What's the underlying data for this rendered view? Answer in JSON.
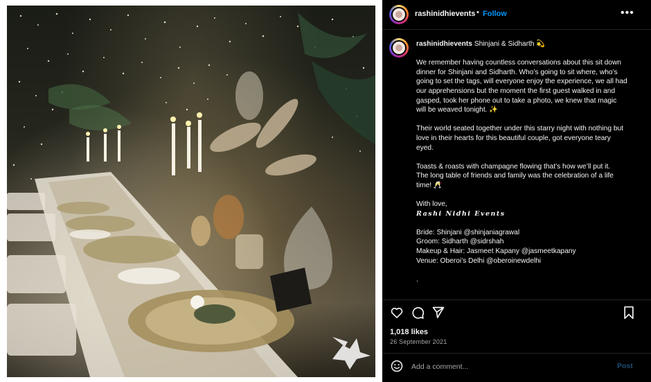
{
  "post": {
    "image_alt": "Candlelit sit-down dinner table under a starry canopy",
    "watermark_icon": "pegasus-icon"
  },
  "header": {
    "username": "rashinidhievents",
    "separator": "•",
    "follow_label": "Follow",
    "more_icon": "more-options-icon",
    "more_label": "•••"
  },
  "caption": {
    "username": "rashinidhievents",
    "title": "Shinjani & Sidharth 💫",
    "paragraph1": "We remember having countless conversations about this sit down dinner for Shinjani and Sidharth. Who’s going to sit where, who’s going to set the tags, will everyone enjoy the experience, we all had our apprehensions but the moment the first guest walked in and gasped, took her phone out to take a photo, we knew that magic will be weaved tonight. ✨",
    "paragraph2": "Their world seated together under this starry night with nothing but love in their hearts for this beautiful couple, got everyone teary eyed.",
    "paragraph3_line1": "Toasts & roasts with champagne flowing that’s how we’ll put it.",
    "paragraph3_line2": "The long table of friends and family was the celebration of a life time! 🥂",
    "signoff": "With love,",
    "signature": "Rashi Nidhi Events",
    "credit_bride": "Bride: Shinjani @shinjaniagrawal",
    "credit_groom": "Groom: Sidharth @sidrshah",
    "credit_makeup": "Makeup & Hair: Jasmeet Kapany @jasmeetkapany",
    "credit_venue": "Venue: Oberoi’s Delhi @oberoinewdelhi",
    "trailing_dot": "."
  },
  "actions": {
    "like_icon": "heart-icon",
    "comment_icon": "comment-bubble-icon",
    "share_icon": "paper-plane-icon",
    "save_icon": "bookmark-icon"
  },
  "stats": {
    "likes": "1,018 likes",
    "date": "26 September 2021"
  },
  "comment": {
    "emoji_icon": "smiley-icon",
    "placeholder": "Add a comment...",
    "post_label": "Post"
  },
  "colors": {
    "panel_bg": "#000000",
    "text": "#f5f5f5",
    "follow": "#0095f6",
    "muted": "#a8a8a8",
    "post_disabled": "#1e4d72",
    "divider": "#262626"
  }
}
